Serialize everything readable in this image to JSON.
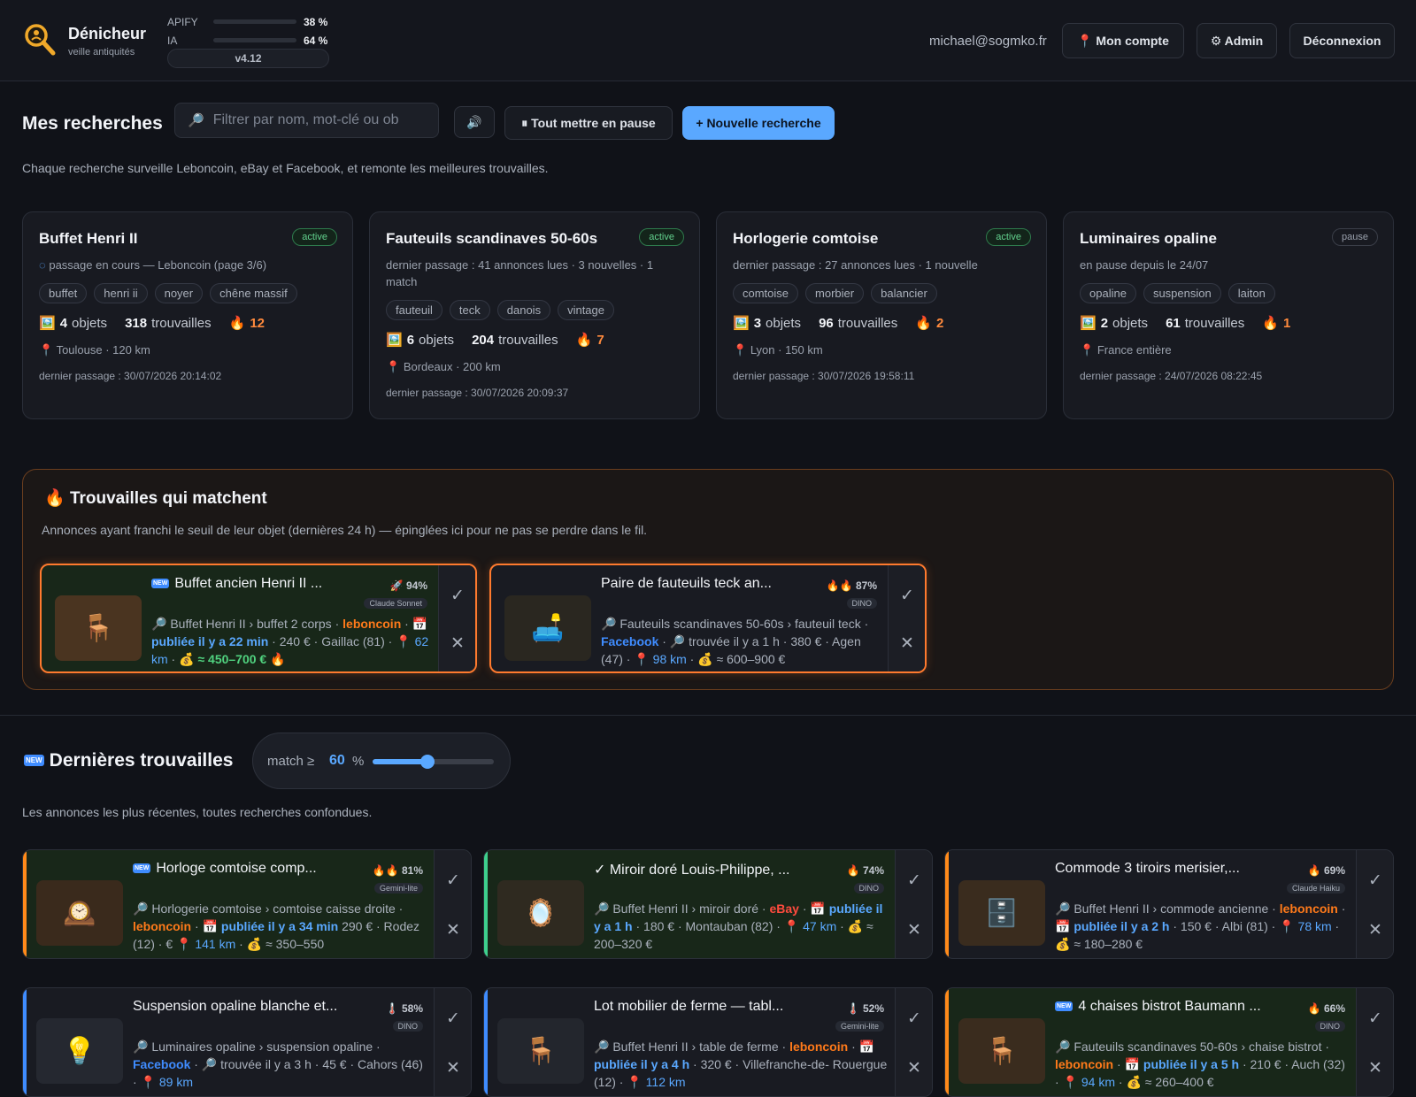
{
  "brand": {
    "name": "Dénicheur",
    "tagline": "veille antiquités"
  },
  "usage": [
    {
      "label": "APIFY",
      "pct": "38 %",
      "value": 0.38,
      "color": "#3ecf8e"
    },
    {
      "label": "IA",
      "pct": "64 %",
      "value": 0.64,
      "color": "#f5a524"
    }
  ],
  "version": "v4.12",
  "user": {
    "email": "michael@sogmko.fr"
  },
  "nav": {
    "account": "📍 Mon compte",
    "admin": "⚙ Admin",
    "logout": "Déconnexion"
  },
  "searches": {
    "title": "Mes recherches",
    "filter_placeholder": "Filtrer par nom, mot-clé ou ob",
    "sound_icon": "🔊",
    "pause_all": "⏸ Tout mettre en pause",
    "new_search": "+ Nouvelle recherche",
    "description": "Chaque recherche surveille Leboncoin, eBay et Facebook, et remonte les meilleures trouvailles.",
    "cards": [
      {
        "name": "Buffet Henri II",
        "status": "active",
        "meta": "passage en cours — Leboncoin (page 3/6)",
        "tags": [
          "buffet",
          "henri ii",
          "noyer",
          "chêne massif"
        ],
        "objects": "4",
        "objects_label": "objets",
        "finds": "318",
        "finds_label": "trouvailles",
        "hot": "12",
        "location": "Toulouse · 120 km",
        "last": "dernier passage : 30/07/2026 20:14:02"
      },
      {
        "name": "Fauteuils scandinaves 50-60s",
        "status": "active",
        "meta": "dernier passage : 41 annonces lues · 3 nouvelles · 1 match",
        "tags": [
          "fauteuil",
          "teck",
          "danois",
          "vintage"
        ],
        "objects": "6",
        "objects_label": "objets",
        "finds": "204",
        "finds_label": "trouvailles",
        "hot": "7",
        "location": "Bordeaux · 200 km",
        "last": "dernier passage : 30/07/2026 20:09:37"
      },
      {
        "name": "Horlogerie comtoise",
        "status": "active",
        "meta": "dernier passage : 27 annonces lues · 1 nouvelle",
        "tags": [
          "comtoise",
          "morbier",
          "balancier"
        ],
        "objects": "3",
        "objects_label": "objets",
        "finds": "96",
        "finds_label": "trouvailles",
        "hot": "2",
        "location": "Lyon · 150 km",
        "last": "dernier passage : 30/07/2026 19:58:11"
      },
      {
        "name": "Luminaires opaline",
        "status": "pause",
        "meta": "en pause depuis le 24/07",
        "tags": [
          "opaline",
          "suspension",
          "laiton"
        ],
        "objects": "2",
        "objects_label": "objets",
        "finds": "61",
        "finds_label": "trouvailles",
        "hot": "1",
        "location": "France entière",
        "last": "dernier passage : 24/07/2026 08:22:45"
      }
    ]
  },
  "matches": {
    "title": "Trouvailles qui matchent",
    "description": "Annonces ayant franchi le seuil de leur objet (dernières 24 h) — épinglées ici pour ne pas se perdre dans le fil.",
    "items": [
      {
        "title": "Buffet ancien Henri II ...",
        "score": "94%",
        "score_icon": "🚀",
        "model": "Claude Sonnet",
        "line1": "Buffet Henri II › buffet 2 corps ·",
        "source": "leboncoin",
        "time": "publiée il y a 22 min",
        "price": "· 240 € ·",
        "city": "Gaillac (81) ·",
        "km": "62 km",
        "estimate": "≈ 450–700 €"
      },
      {
        "title": "Paire de fauteuils teck an...",
        "score": "87%",
        "score_icon": "🔥🔥",
        "model": "DINO",
        "line1": "Fauteuils scandinaves 50-60s › fauteuil",
        "pre": "teck ·",
        "source": "Facebook",
        "time": "trouvée il y a 1 h",
        "price": "· 380 €",
        "city": "· Agen (47) ·",
        "km": "98 km",
        "estimate": "≈ 600–900 €"
      }
    ]
  },
  "latest": {
    "title": "Dernières trouvailles",
    "slider_label": "match ≥",
    "slider_value": "60",
    "slider_unit": "%",
    "slider_fraction": 0.6,
    "description": "Les annonces les plus récentes, toutes recherches confondues.",
    "items": [
      {
        "title": "Horloge comtoise comp...",
        "score": "81%",
        "score_icon": "🔥🔥",
        "model": "Gemini-lite",
        "icon": "🕰️",
        "line1": "Horlogerie comtoise › comtoise caisse",
        "line2a": "droite ·",
        "source": "leboncoin",
        "time": "publiée il y a 34 min",
        "line3": "290 € · Rodez (12) ·",
        "km": "141 km",
        "estimate": "≈ 350–550",
        "line4": "€"
      },
      {
        "title": "✓ Miroir doré Louis-Philippe, ...",
        "score": "74%",
        "score_icon": "🔥",
        "model": "DINO",
        "icon": "🪞",
        "line1": "Buffet Henri II › miroir doré ·",
        "source": "eBay",
        "time": "publiée il y a 1 h",
        "line3": "· 180 € · Montauban (82) ·",
        "km": "47 km",
        "estimate": "≈ 200–320 €"
      },
      {
        "title": "Commode 3 tiroirs merisier,...",
        "score": "69%",
        "score_icon": "🔥",
        "model": "Claude Haiku",
        "icon": "🗄️",
        "line1": "Buffet Henri II › commode ancienne ·",
        "source": "leboncoin",
        "time": "publiée il y a 2 h",
        "line3": "· 150 € · Albi",
        "line4": "(81) ·",
        "km": "78 km",
        "estimate": "≈ 180–280 €"
      },
      {
        "title": "Suspension opaline blanche et...",
        "score": "58%",
        "score_icon": "🌡️",
        "model": "DINO",
        "icon": "💡",
        "line1": "Luminaires opaline › suspension opaline ·",
        "source": "Facebook",
        "time": "trouvée il y a 3 h",
        "line3": "· 45 € · Cahors",
        "line4": "(46) ·",
        "km": "89 km"
      },
      {
        "title": "Lot mobilier de ferme — tabl...",
        "score": "52%",
        "score_icon": "🌡️",
        "model": "Gemini-lite",
        "icon": "🪑",
        "line1": "Buffet Henri II › table de ferme ·",
        "source": "leboncoin",
        "time": "publiée il y a 4 h",
        "line3": "· 320 € · Villefranche-de-",
        "line4": "Rouergue (12) ·",
        "km": "112 km"
      },
      {
        "title": "4 chaises bistrot Baumann ...",
        "score": "66%",
        "score_icon": "🔥",
        "model": "DINO",
        "icon": "🪑",
        "line1": "Fauteuils scandinaves 50-60s › chaise",
        "line2a": "bistrot ·",
        "source": "leboncoin",
        "time": "publiée il y a 5 h",
        "line3": "· 210",
        "line4": "€ · Auch (32) ·",
        "km": "94 km",
        "estimate": "≈ 260–400 €"
      }
    ]
  }
}
